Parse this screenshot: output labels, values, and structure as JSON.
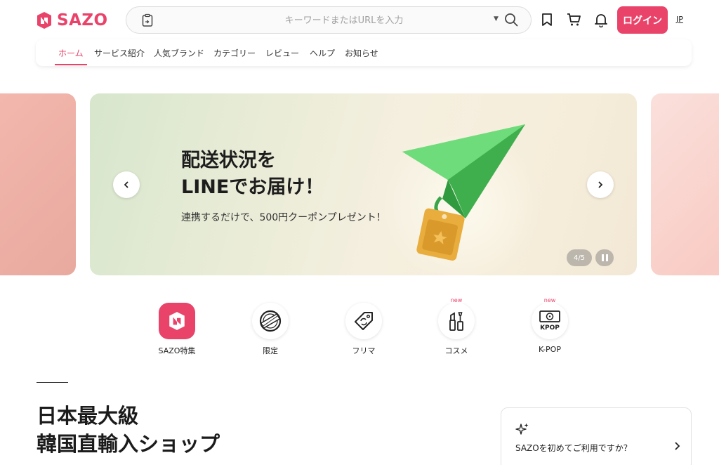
{
  "header": {
    "logo_text": "SAZO",
    "search_placeholder": "キーワードまたはURLを入力",
    "login_label": "ログイン",
    "language": "JP",
    "icons": [
      "clipboard-icon",
      "search-icon",
      "bookmark-icon",
      "cart-icon",
      "bell-icon"
    ]
  },
  "nav": {
    "items": [
      {
        "label": "ホーム",
        "active": true
      },
      {
        "label": "サービス紹介"
      },
      {
        "label": "人気ブランド"
      },
      {
        "label": "カテゴリー"
      },
      {
        "label": "レビュー"
      },
      {
        "label": "ヘルプ"
      },
      {
        "label": "お知らせ"
      }
    ]
  },
  "banner": {
    "title_line1": "配送状況を",
    "title_line2": "LINEでお届け！",
    "subtitle": "連携するだけで、500円クーポンプレゼント！",
    "counter": "4/5"
  },
  "categories": [
    {
      "label": "SAZO特集",
      "icon": "sazo-logo-icon",
      "new": false
    },
    {
      "label": "限定",
      "icon": "limited-stamp-icon",
      "new": false
    },
    {
      "label": "フリマ",
      "icon": "price-tag-icon",
      "new": false
    },
    {
      "label": "コスメ",
      "icon": "cosmetics-icon",
      "new": true,
      "badge": "new"
    },
    {
      "label": "K-POP",
      "icon": "kpop-icon",
      "new": true,
      "badge": "new",
      "icon_text": "KPOP"
    }
  ],
  "intro": {
    "title_line1": "日本最大級",
    "title_line2": "韓国直輸入ショップ",
    "card_text": "SAZOを初めてご利用ですか？"
  },
  "colors": {
    "brand": "#e9436a",
    "plane": "#4cc35a",
    "tag": "#e9b040"
  }
}
